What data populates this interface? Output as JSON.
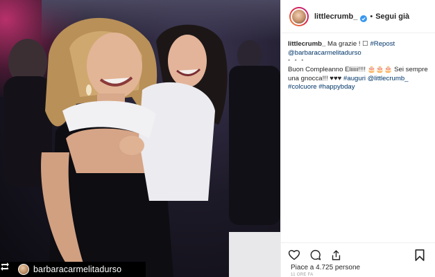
{
  "photo": {
    "repost_user": "barbaracarmelitadurso"
  },
  "header": {
    "username": "littlecrumb_",
    "separator": "•",
    "follow_label": "Segui già"
  },
  "caption": {
    "line1_user": "littlecrumb_",
    "line1_text": " Ma grazie ! ☐ ",
    "line1_tag": "#Repost",
    "line2_mention": "@barbaracarmelitadurso",
    "dots": "• • •",
    "line3_text": "Buon Compleanno Eliiiii!!!! 🎂🎂🎂 Sei sempre una gnocca!!! ♥♥♥ ",
    "line3_tag": "#auguri",
    "line3_mention": "@littlecrumb_",
    "line4_tag1": "#colcuore",
    "line4_tag2": "#happybday"
  },
  "actions": {
    "like_icon": "heart-icon",
    "comment_icon": "comment-icon",
    "share_icon": "share-icon",
    "save_icon": "bookmark-icon",
    "likes_text": "Piace a 4.725 persone",
    "time_text": "11 ORE FA"
  },
  "colors": {
    "link": "#003569",
    "text": "#262626",
    "muted": "#999999",
    "border": "#efefef"
  }
}
